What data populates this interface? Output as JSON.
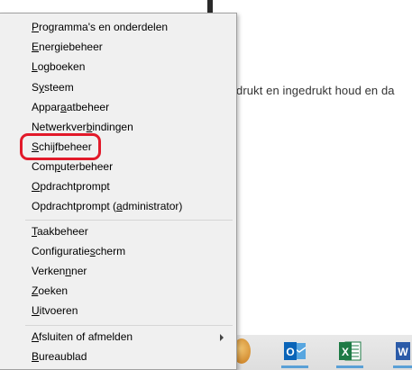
{
  "background": {
    "text": "drukt en ingedrukt houd en da"
  },
  "menu": {
    "items": [
      {
        "label": "Programma's en onderdelen",
        "accel": "P",
        "rest": "rogramma's en onderdelen"
      },
      {
        "label": "Energiebeheer",
        "accel": "E",
        "rest": "nergiebeheer"
      },
      {
        "label": "Logboeken",
        "accel": "L",
        "rest": "ogboeken"
      },
      {
        "label": "Systeem",
        "pre": "S",
        "accel": "y",
        "rest": "steem"
      },
      {
        "label": "Apparaatbeheer",
        "pre": "Appar",
        "accel": "a",
        "rest": "atbeheer"
      },
      {
        "label": "Netwerkverbindingen",
        "pre": "Netwerkver",
        "accel": "b",
        "rest": "indingen"
      },
      {
        "label": "Schijfbeheer",
        "accel": "S",
        "rest": "chijfbeheer"
      },
      {
        "label": "Computerbeheer",
        "pre": "Com",
        "accel": "p",
        "rest": "uterbeheer"
      },
      {
        "label": "Opdrachtprompt",
        "accel": "O",
        "rest": "pdrachtprompt"
      },
      {
        "label": "Opdrachtprompt (administrator)",
        "pre": "Opdrachtprompt (",
        "accel": "a",
        "rest": "dministrator)"
      },
      {
        "label": "Taakbeheer",
        "accel": "T",
        "rest": "aakbeheer"
      },
      {
        "label": "Configuratiescherm",
        "pre": "Configuratie",
        "accel": "s",
        "rest": "cherm"
      },
      {
        "label": "Verkenner",
        "pre": "Verken",
        "accel": "n",
        "rest": "ner"
      },
      {
        "label": "Zoeken",
        "accel": "Z",
        "rest": "oeken"
      },
      {
        "label": "Uitvoeren",
        "accel": "U",
        "rest": "itvoeren"
      },
      {
        "label": "Afsluiten of afmelden",
        "accel": "A",
        "rest": "fsluiten of afmelden"
      },
      {
        "label": "Bureaublad",
        "accel": "B",
        "rest": "ureaublad"
      }
    ],
    "highlighted": "Schijfbeheer",
    "highlight_color": "#e21a2a"
  },
  "taskbar": {
    "icons": [
      "app-icon",
      "outlook-icon",
      "excel-icon",
      "word-icon"
    ],
    "outlook_letter": "O",
    "excel_letter": "X",
    "word_letter": "W",
    "accent": "#5aa0d6"
  }
}
